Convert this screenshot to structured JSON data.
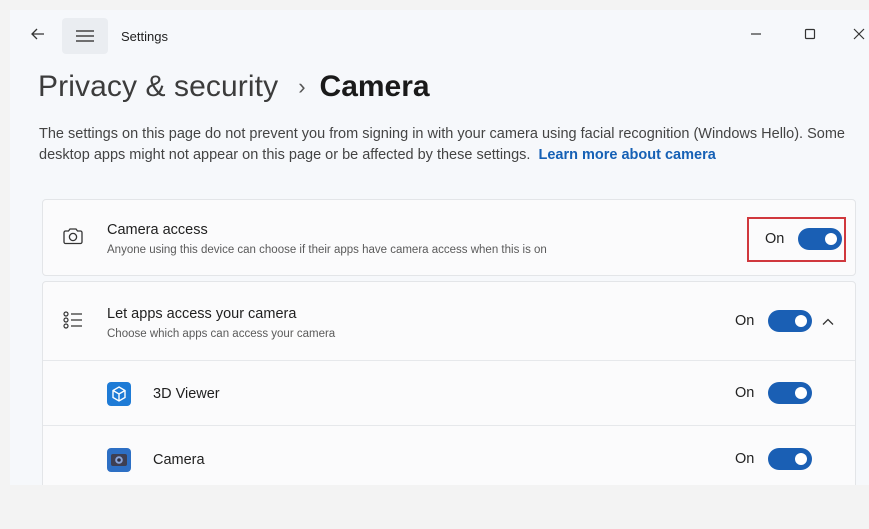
{
  "window": {
    "app_title": "Settings"
  },
  "header": {
    "breadcrumb_parent": "Privacy & security",
    "breadcrumb_separator": "›",
    "breadcrumb_current": "Camera"
  },
  "description": {
    "text": "The settings on this page do not prevent you from signing in with your camera using facial recognition (Windows Hello). Some desktop apps might not appear on this page or be affected by these settings.",
    "link": "Learn more about camera"
  },
  "camera_access": {
    "icon": "camera-icon",
    "title": "Camera access",
    "subtitle": "Anyone using this device can choose if their apps have camera access when this is on",
    "toggle_label": "On",
    "toggle_state": true
  },
  "apps_access": {
    "icon": "list-settings-icon",
    "title": "Let apps access your camera",
    "subtitle": "Choose which apps can access your camera",
    "toggle_label": "On",
    "toggle_state": true,
    "expanded": true,
    "apps": [
      {
        "name": "3D Viewer",
        "icon": "3d-viewer-icon",
        "toggle_label": "On",
        "toggle_state": true
      },
      {
        "name": "Camera",
        "icon": "camera-app-icon",
        "toggle_label": "On",
        "toggle_state": true
      }
    ]
  },
  "colors": {
    "accent": "#1a5fb4",
    "link": "#1560b5",
    "highlight_box": "#d0383d",
    "app_icon_bg": "#1e7bd6"
  }
}
